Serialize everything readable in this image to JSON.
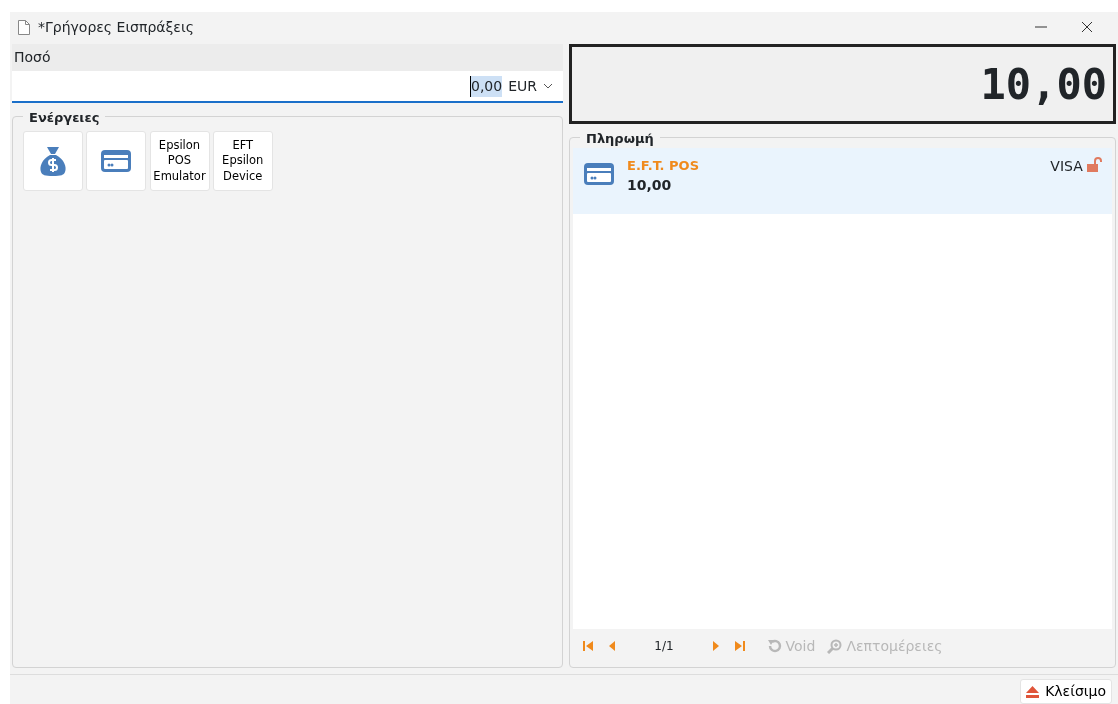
{
  "window": {
    "title": "*Γρήγορες Εισπράξεις"
  },
  "amount": {
    "label": "Ποσό",
    "value": "0,00",
    "currency": "EUR"
  },
  "actions": {
    "title": "Ενέργειες",
    "buttons": [
      {
        "kind": "cash"
      },
      {
        "kind": "card"
      },
      {
        "kind": "text",
        "label": "Epsilon POS Emulator"
      },
      {
        "kind": "text",
        "label": "EFT Epsilon Device"
      }
    ]
  },
  "display": {
    "total": "10,00"
  },
  "payment": {
    "title": "Πληρωμή",
    "items": [
      {
        "method": "E.F.T. POS",
        "amount": "10,00",
        "card": "VISA",
        "locked": false,
        "selected": true
      }
    ]
  },
  "pager": {
    "page": "1/1",
    "actions": [
      {
        "kind": "void",
        "label": "Void",
        "disabled": true
      },
      {
        "kind": "details",
        "label": "Λεπτομέρειες",
        "disabled": true
      }
    ]
  },
  "close_button": {
    "label": "Κλείσιμο"
  }
}
